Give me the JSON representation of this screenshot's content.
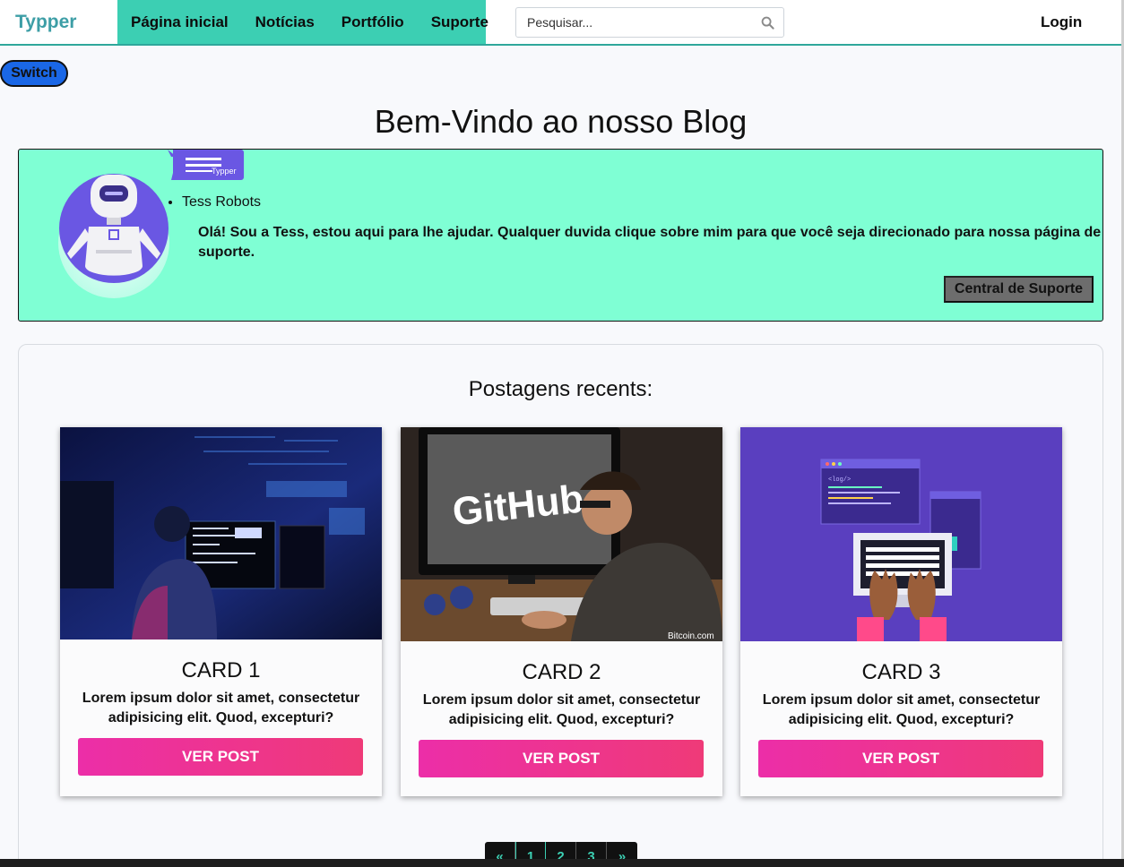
{
  "nav": {
    "brand": "Typper",
    "links": [
      "Página inicial",
      "Notícias",
      "Portfólio",
      "Suporte"
    ],
    "search_placeholder": "Pesquisar...",
    "login": "Login"
  },
  "switch_label": "Switch",
  "page_title": "Bem-Vindo ao nosso Blog",
  "bot": {
    "bubble_text": "Typper",
    "name": "Tess Robots",
    "description": "Olá! Sou a Tess, estou aqui para lhe ajudar. Qualquer duvida clique sobre mim para que você seja direcionado para nossa página de suporte.",
    "button": "Central de Suporte"
  },
  "posts": {
    "title": "Postagens recents:",
    "cards": [
      {
        "title": "CARD 1",
        "text": "Lorem ipsum dolor sit amet, consectetur adipisicing elit. Quod, excepturi?",
        "button": "VER POST"
      },
      {
        "title": "CARD 2",
        "text": "Lorem ipsum dolor sit amet, consectetur adipisicing elit. Quod, excepturi?",
        "button": "VER POST",
        "image_text": "GitHub",
        "image_caption": "Bitcoin.com"
      },
      {
        "title": "CARD 3",
        "text": "Lorem ipsum dolor sit amet, consectetur adipisicing elit. Quod, excepturi?",
        "button": "VER POST",
        "image_text": "<log/>"
      }
    ]
  },
  "pagination": [
    "«",
    "1",
    "2",
    "3",
    "»"
  ],
  "colors": {
    "nav_accent": "#3ccfb3",
    "brand": "#3d9ea6",
    "banner_bg": "#7fffd4",
    "switch_bg": "#1a67e6",
    "button_gradient_start": "#ec2ea8",
    "button_gradient_end": "#ef3a78"
  }
}
